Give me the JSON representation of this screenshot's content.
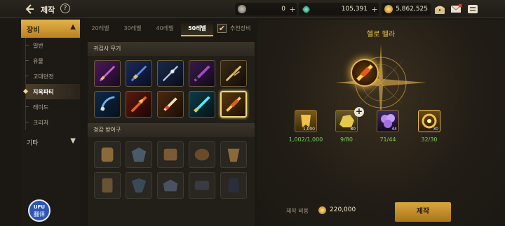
{
  "header": {
    "title": "제작",
    "back_icon": "back-arrow-icon",
    "help_icon": "help-icon",
    "help_glyph": "?"
  },
  "currencies": [
    {
      "icon": "silver-coin-icon",
      "value": "0",
      "plus": "+"
    },
    {
      "icon": "gem-icon",
      "value": "105,391",
      "plus": "+"
    },
    {
      "icon": "gold-coin-icon",
      "value": "5,862,525",
      "plus": "+"
    }
  ],
  "top_icons": [
    "chest-icon",
    "mail-icon",
    "menu-icon"
  ],
  "sidebar": {
    "category": "장비",
    "items": [
      {
        "label": "일반"
      },
      {
        "label": "유물"
      },
      {
        "label": "고대던전"
      },
      {
        "label": "지옥파티"
      },
      {
        "label": "레이드"
      },
      {
        "label": "크리처"
      }
    ],
    "other": "기타"
  },
  "tabs": [
    {
      "label": "20레벨"
    },
    {
      "label": "30레벨"
    },
    {
      "label": "40레벨"
    },
    {
      "label": "50레벨"
    }
  ],
  "recommend": {
    "label": "추천장비",
    "checked": true,
    "check_glyph": "✔"
  },
  "sections": {
    "weapons": "귀검사 무기",
    "armor": "경갑 방어구"
  },
  "selected_item": {
    "name": "헬로 헬라"
  },
  "materials": [
    {
      "qty": "1,000",
      "count": "1,002/1,000",
      "icon": "material-crest-icon"
    },
    {
      "qty": "80",
      "count": "9/80",
      "icon": "material-gold-ore-icon"
    },
    {
      "qty": "44",
      "count": "71/44",
      "icon": "material-purple-orb-icon"
    },
    {
      "qty": "30",
      "count": "32/30",
      "icon": "material-ring-icon"
    }
  ],
  "add_glyph": "+",
  "cost": {
    "label": "제작 비용",
    "value": "220,000"
  },
  "craft_button": "제작",
  "translate_badge": {
    "line1": "UFU",
    "line2": "翻译"
  },
  "colors": {
    "accent_gold": "#e8b84a",
    "ok_green": "#7bcf5a",
    "name_gold": "#e9c14a"
  }
}
